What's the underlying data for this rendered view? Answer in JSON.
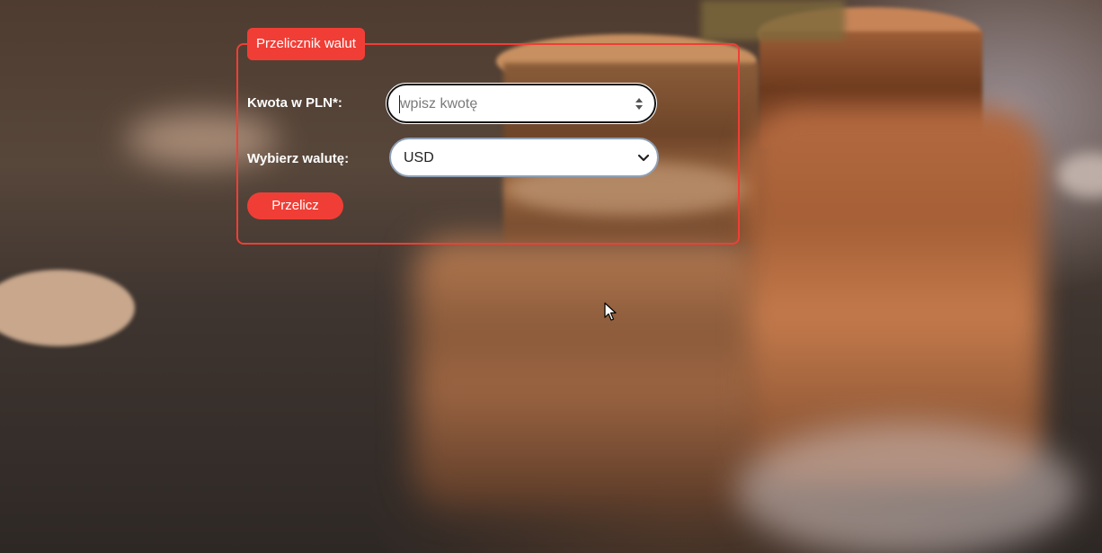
{
  "form": {
    "title": "Przelicznik walut",
    "amount_label": "Kwota w PLN*:",
    "amount_placeholder": "wpisz kwotę",
    "amount_value": "",
    "currency_label": "Wybierz walutę:",
    "currency_selected": "USD",
    "submit_label": "Przelicz"
  },
  "colors": {
    "accent": "#f03e36",
    "text_light": "#ffffff"
  },
  "icons": {
    "spinner": "number-spinner-icon",
    "select_arrow": "chevron-down-icon",
    "cursor": "mouse-pointer-icon"
  }
}
